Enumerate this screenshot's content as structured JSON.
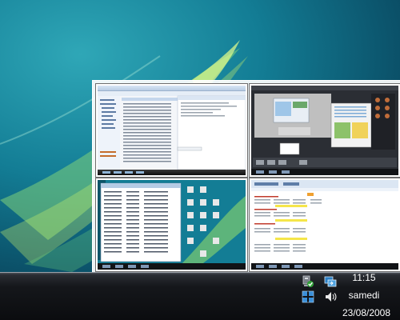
{
  "tray": {
    "icons": [
      "network-status-icon",
      "taskbar-switch-icon",
      "windows-flip-icon",
      "volume-icon"
    ]
  },
  "clock": {
    "time": "11:15",
    "day": "samedi",
    "date": "23/08/2008"
  },
  "switcher": {
    "windows": [
      {
        "name": "file-explorer-window"
      },
      {
        "name": "photo-editor-window"
      },
      {
        "name": "desktop-list-window"
      },
      {
        "name": "spreadsheet-window"
      }
    ]
  },
  "colors": {
    "desktop": "#137d95",
    "taskbar": "#0b0c0f",
    "highlight_yellow": "#f5e64a",
    "highlight_red": "#c0392b"
  }
}
